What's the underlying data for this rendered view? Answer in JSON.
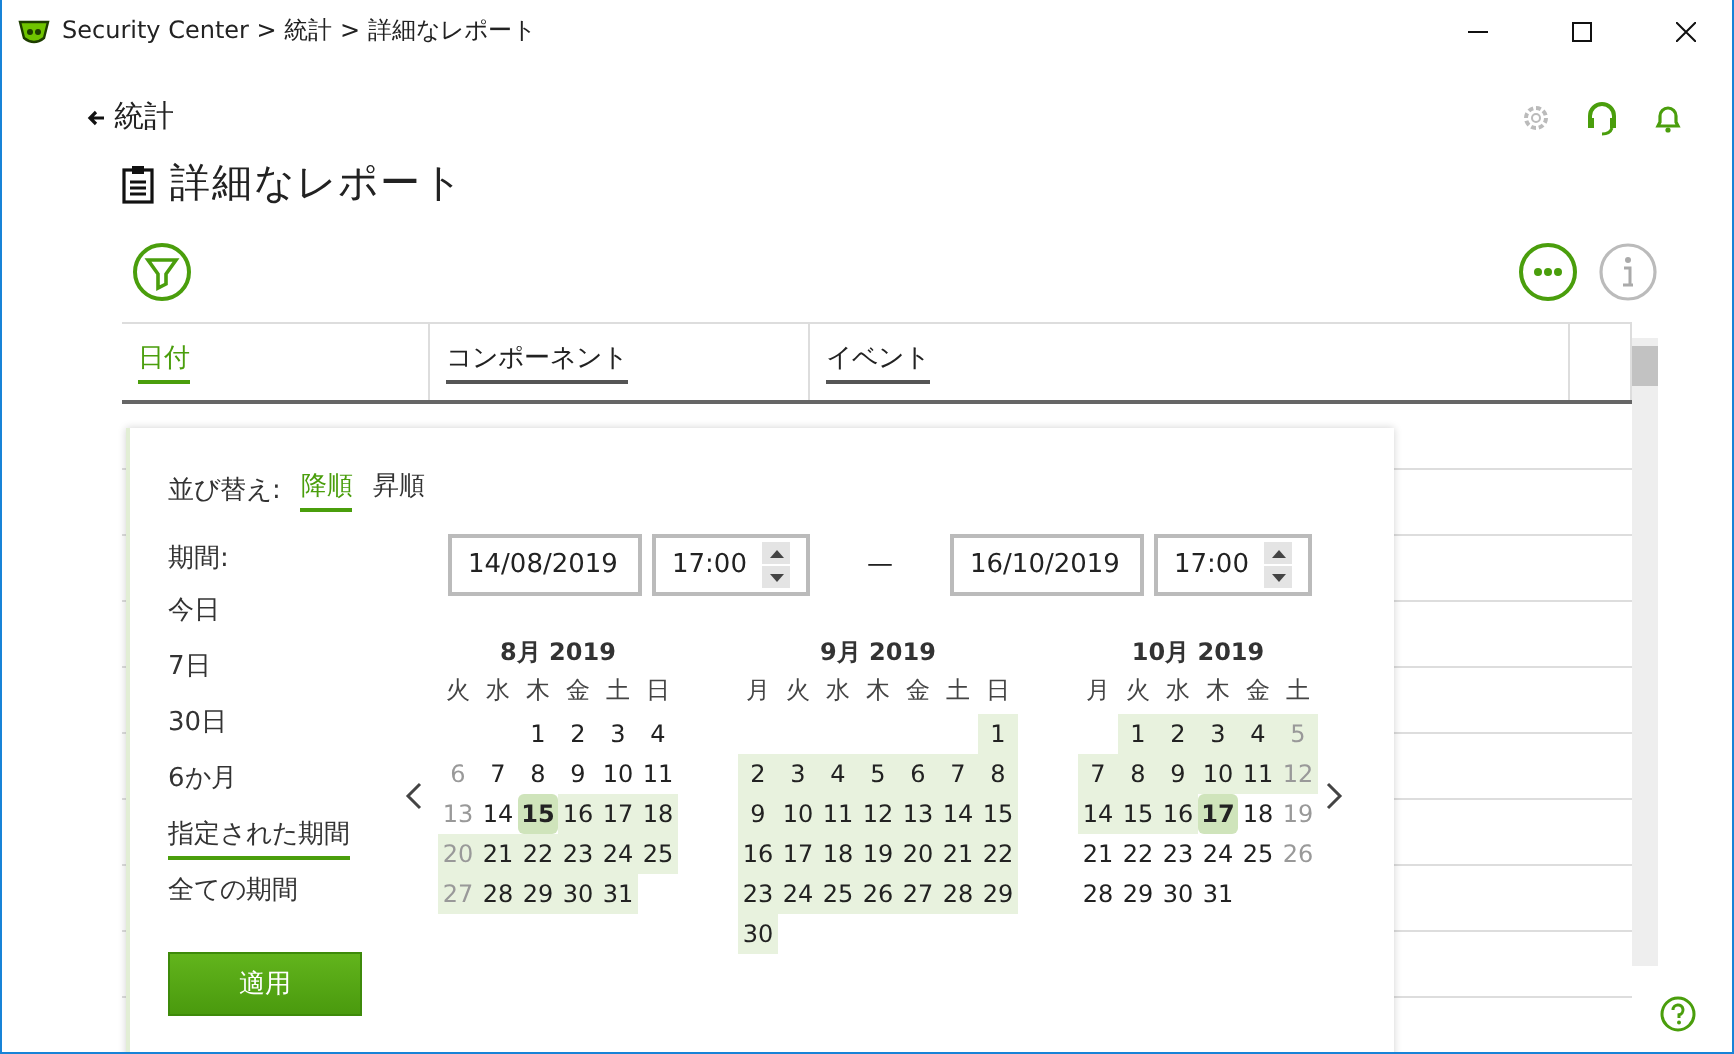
{
  "window": {
    "title": "Security Center > 統計 > 詳細なレポート"
  },
  "header": {
    "back_label": "統計",
    "page_title": "詳細なレポート"
  },
  "table": {
    "columns": [
      {
        "label": "日付",
        "selected": true
      },
      {
        "label": "コンポーネント",
        "selected": false
      },
      {
        "label": "イベント",
        "selected": false
      }
    ]
  },
  "filter_panel": {
    "sort_label": "並び替え:",
    "sort_options": [
      {
        "label": "降順",
        "selected": true
      },
      {
        "label": "昇順",
        "selected": false
      }
    ],
    "period_label": "期間:",
    "periods": [
      {
        "label": "今日",
        "selected": false
      },
      {
        "label": "7日",
        "selected": false
      },
      {
        "label": "30日",
        "selected": false
      },
      {
        "label": "6か月",
        "selected": false
      },
      {
        "label": "指定された期間",
        "selected": true
      },
      {
        "label": "全ての期間",
        "selected": false
      }
    ],
    "start_date": "14/08/2019",
    "start_time": "17:00",
    "separator": "—",
    "end_date": "16/10/2019",
    "end_time": "17:00",
    "months": [
      {
        "title": "8月 2019",
        "weekdays": [
          "火",
          "水",
          "木",
          "金",
          "土",
          "日"
        ],
        "weeks": [
          [
            {
              "kind": "blank"
            },
            {
              "kind": "blank"
            },
            {
              "kind": "day",
              "day": "1",
              "range": false,
              "selected": false,
              "faded": false
            },
            {
              "kind": "day",
              "day": "2",
              "range": false,
              "selected": false,
              "faded": false
            },
            {
              "kind": "day",
              "day": "3",
              "range": false,
              "selected": false,
              "faded": false
            },
            {
              "kind": "day",
              "day": "4",
              "range": false,
              "selected": false,
              "faded": false
            }
          ],
          [
            {
              "kind": "day",
              "day": "6",
              "range": false,
              "selected": false,
              "faded": true
            },
            {
              "kind": "day",
              "day": "7",
              "range": false,
              "selected": false,
              "faded": false
            },
            {
              "kind": "day",
              "day": "8",
              "range": false,
              "selected": false,
              "faded": false
            },
            {
              "kind": "day",
              "day": "9",
              "range": false,
              "selected": false,
              "faded": false
            },
            {
              "kind": "day",
              "day": "10",
              "range": false,
              "selected": false,
              "faded": false
            },
            {
              "kind": "day",
              "day": "11",
              "range": false,
              "selected": false,
              "faded": false
            }
          ],
          [
            {
              "kind": "day",
              "day": "13",
              "range": false,
              "selected": false,
              "faded": true
            },
            {
              "kind": "day",
              "day": "14",
              "range": false,
              "selected": false,
              "faded": false
            },
            {
              "kind": "day",
              "day": "15",
              "range": true,
              "selected": true,
              "faded": false
            },
            {
              "kind": "day",
              "day": "16",
              "range": true,
              "selected": false,
              "faded": false
            },
            {
              "kind": "day",
              "day": "17",
              "range": true,
              "selected": false,
              "faded": false
            },
            {
              "kind": "day",
              "day": "18",
              "range": true,
              "selected": false,
              "faded": false
            }
          ],
          [
            {
              "kind": "day",
              "day": "20",
              "range": true,
              "selected": false,
              "faded": true
            },
            {
              "kind": "day",
              "day": "21",
              "range": true,
              "selected": false,
              "faded": false
            },
            {
              "kind": "day",
              "day": "22",
              "range": true,
              "selected": false,
              "faded": false
            },
            {
              "kind": "day",
              "day": "23",
              "range": true,
              "selected": false,
              "faded": false
            },
            {
              "kind": "day",
              "day": "24",
              "range": true,
              "selected": false,
              "faded": false
            },
            {
              "kind": "day",
              "day": "25",
              "range": true,
              "selected": false,
              "faded": false
            }
          ],
          [
            {
              "kind": "day",
              "day": "27",
              "range": true,
              "selected": false,
              "faded": true
            },
            {
              "kind": "day",
              "day": "28",
              "range": true,
              "selected": false,
              "faded": false
            },
            {
              "kind": "day",
              "day": "29",
              "range": true,
              "selected": false,
              "faded": false
            },
            {
              "kind": "day",
              "day": "30",
              "range": true,
              "selected": false,
              "faded": false
            },
            {
              "kind": "day",
              "day": "31",
              "range": true,
              "selected": false,
              "faded": false
            }
          ]
        ]
      },
      {
        "title": "9月 2019",
        "weekdays": [
          "月",
          "火",
          "水",
          "木",
          "金",
          "土",
          "日"
        ],
        "weeks": [
          [
            {
              "kind": "blank"
            },
            {
              "kind": "blank"
            },
            {
              "kind": "blank"
            },
            {
              "kind": "blank"
            },
            {
              "kind": "blank"
            },
            {
              "kind": "blank"
            },
            {
              "kind": "day",
              "day": "1",
              "range": true,
              "selected": false,
              "faded": false
            }
          ],
          [
            {
              "kind": "day",
              "day": "2",
              "range": true,
              "selected": false,
              "faded": false
            },
            {
              "kind": "day",
              "day": "3",
              "range": true,
              "selected": false,
              "faded": false
            },
            {
              "kind": "day",
              "day": "4",
              "range": true,
              "selected": false,
              "faded": false
            },
            {
              "kind": "day",
              "day": "5",
              "range": true,
              "selected": false,
              "faded": false
            },
            {
              "kind": "day",
              "day": "6",
              "range": true,
              "selected": false,
              "faded": false
            },
            {
              "kind": "day",
              "day": "7",
              "range": true,
              "selected": false,
              "faded": false
            },
            {
              "kind": "day",
              "day": "8",
              "range": true,
              "selected": false,
              "faded": false
            }
          ],
          [
            {
              "kind": "day",
              "day": "9",
              "range": true,
              "selected": false,
              "faded": false
            },
            {
              "kind": "day",
              "day": "10",
              "range": true,
              "selected": false,
              "faded": false
            },
            {
              "kind": "day",
              "day": "11",
              "range": true,
              "selected": false,
              "faded": false
            },
            {
              "kind": "day",
              "day": "12",
              "range": true,
              "selected": false,
              "faded": false
            },
            {
              "kind": "day",
              "day": "13",
              "range": true,
              "selected": false,
              "faded": false
            },
            {
              "kind": "day",
              "day": "14",
              "range": true,
              "selected": false,
              "faded": false
            },
            {
              "kind": "day",
              "day": "15",
              "range": true,
              "selected": false,
              "faded": false
            }
          ],
          [
            {
              "kind": "day",
              "day": "16",
              "range": true,
              "selected": false,
              "faded": false
            },
            {
              "kind": "day",
              "day": "17",
              "range": true,
              "selected": false,
              "faded": false
            },
            {
              "kind": "day",
              "day": "18",
              "range": true,
              "selected": false,
              "faded": false
            },
            {
              "kind": "day",
              "day": "19",
              "range": true,
              "selected": false,
              "faded": false
            },
            {
              "kind": "day",
              "day": "20",
              "range": true,
              "selected": false,
              "faded": false
            },
            {
              "kind": "day",
              "day": "21",
              "range": true,
              "selected": false,
              "faded": false
            },
            {
              "kind": "day",
              "day": "22",
              "range": true,
              "selected": false,
              "faded": false
            }
          ],
          [
            {
              "kind": "day",
              "day": "23",
              "range": true,
              "selected": false,
              "faded": false
            },
            {
              "kind": "day",
              "day": "24",
              "range": true,
              "selected": false,
              "faded": false
            },
            {
              "kind": "day",
              "day": "25",
              "range": true,
              "selected": false,
              "faded": false
            },
            {
              "kind": "day",
              "day": "26",
              "range": true,
              "selected": false,
              "faded": false
            },
            {
              "kind": "day",
              "day": "27",
              "range": true,
              "selected": false,
              "faded": false
            },
            {
              "kind": "day",
              "day": "28",
              "range": true,
              "selected": false,
              "faded": false
            },
            {
              "kind": "day",
              "day": "29",
              "range": true,
              "selected": false,
              "faded": false
            }
          ],
          [
            {
              "kind": "day",
              "day": "30",
              "range": true,
              "selected": false,
              "faded": false
            }
          ]
        ]
      },
      {
        "title": "10月 2019",
        "weekdays": [
          "月",
          "火",
          "水",
          "木",
          "金",
          "土"
        ],
        "weeks": [
          [
            {
              "kind": "blank"
            },
            {
              "kind": "day",
              "day": "1",
              "range": true,
              "selected": false,
              "faded": false
            },
            {
              "kind": "day",
              "day": "2",
              "range": true,
              "selected": false,
              "faded": false
            },
            {
              "kind": "day",
              "day": "3",
              "range": true,
              "selected": false,
              "faded": false
            },
            {
              "kind": "day",
              "day": "4",
              "range": true,
              "selected": false,
              "faded": false
            },
            {
              "kind": "day",
              "day": "5",
              "range": true,
              "selected": false,
              "faded": true
            }
          ],
          [
            {
              "kind": "day",
              "day": "7",
              "range": true,
              "selected": false,
              "faded": false
            },
            {
              "kind": "day",
              "day": "8",
              "range": true,
              "selected": false,
              "faded": false
            },
            {
              "kind": "day",
              "day": "9",
              "range": true,
              "selected": false,
              "faded": false
            },
            {
              "kind": "day",
              "day": "10",
              "range": true,
              "selected": false,
              "faded": false
            },
            {
              "kind": "day",
              "day": "11",
              "range": true,
              "selected": false,
              "faded": false
            },
            {
              "kind": "day",
              "day": "12",
              "range": true,
              "selected": false,
              "faded": true
            }
          ],
          [
            {
              "kind": "day",
              "day": "14",
              "range": true,
              "selected": false,
              "faded": false
            },
            {
              "kind": "day",
              "day": "15",
              "range": true,
              "selected": false,
              "faded": false
            },
            {
              "kind": "day",
              "day": "16",
              "range": true,
              "selected": false,
              "faded": false
            },
            {
              "kind": "day",
              "day": "17",
              "range": true,
              "selected": true,
              "faded": false
            },
            {
              "kind": "day",
              "day": "18",
              "range": false,
              "selected": false,
              "faded": false
            },
            {
              "kind": "day",
              "day": "19",
              "range": false,
              "selected": false,
              "faded": true
            }
          ],
          [
            {
              "kind": "day",
              "day": "21",
              "range": false,
              "selected": false,
              "faded": false
            },
            {
              "kind": "day",
              "day": "22",
              "range": false,
              "selected": false,
              "faded": false
            },
            {
              "kind": "day",
              "day": "23",
              "range": false,
              "selected": false,
              "faded": false
            },
            {
              "kind": "day",
              "day": "24",
              "range": false,
              "selected": false,
              "faded": false
            },
            {
              "kind": "day",
              "day": "25",
              "range": false,
              "selected": false,
              "faded": false
            },
            {
              "kind": "day",
              "day": "26",
              "range": false,
              "selected": false,
              "faded": true
            }
          ],
          [
            {
              "kind": "day",
              "day": "28",
              "range": false,
              "selected": false,
              "faded": false
            },
            {
              "kind": "day",
              "day": "29",
              "range": false,
              "selected": false,
              "faded": false
            },
            {
              "kind": "day",
              "day": "30",
              "range": false,
              "selected": false,
              "faded": false
            },
            {
              "kind": "day",
              "day": "31",
              "range": false,
              "selected": false,
              "faded": false
            }
          ]
        ]
      }
    ],
    "apply_label": "適用"
  }
}
